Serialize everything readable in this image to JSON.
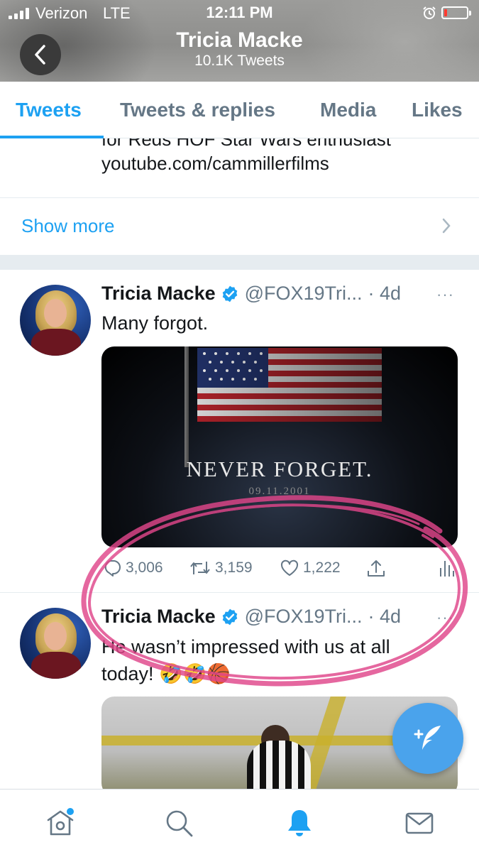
{
  "status_bar": {
    "carrier": "Verizon",
    "network": "LTE",
    "time": "12:11 PM",
    "battery_level": 0.12,
    "battery_color": "#ff3b30"
  },
  "header": {
    "title": "Tricia Macke",
    "subtitle": "10.1K Tweets",
    "back_icon": "chevron-left-icon"
  },
  "tabs": [
    {
      "label": "Tweets",
      "active": true
    },
    {
      "label": "Tweets & replies",
      "active": false
    },
    {
      "label": "Media",
      "active": false
    },
    {
      "label": "Likes",
      "active": false
    }
  ],
  "bio": {
    "partial_line": "for Reds HOF Star Wars enthusiast",
    "link": "youtube.com/cammillerfilms"
  },
  "show_more": {
    "label": "Show more",
    "icon": "chevron-right-icon"
  },
  "tweets": [
    {
      "name": "Tricia Macke",
      "verified": true,
      "handle": "@FOX19Tri...",
      "time": "· 4d",
      "more": "···",
      "text": "Many forgot.",
      "media": {
        "caption": "NEVER FORGET.",
        "date": "09.11.2001"
      },
      "actions": {
        "replies": "3,006",
        "retweets": "3,159",
        "likes": "1,222"
      }
    },
    {
      "name": "Tricia Macke",
      "verified": true,
      "handle": "@FOX19Tri...",
      "time": "· 4d",
      "more": "···",
      "text": "He wasn’t impressed with us at all today! 🤣🤣🏀"
    }
  ],
  "fab": {
    "icon": "compose-tweet-icon"
  },
  "bottom_nav": [
    {
      "icon": "home-icon",
      "active": false,
      "has_notification_dot": true
    },
    {
      "icon": "search-icon",
      "active": false
    },
    {
      "icon": "notifications-bell-icon",
      "active": true
    },
    {
      "icon": "messages-envelope-icon",
      "active": false
    }
  ],
  "colors": {
    "accent": "#1da1f2",
    "secondary_text": "#657786",
    "annotation": "#e0468a"
  }
}
